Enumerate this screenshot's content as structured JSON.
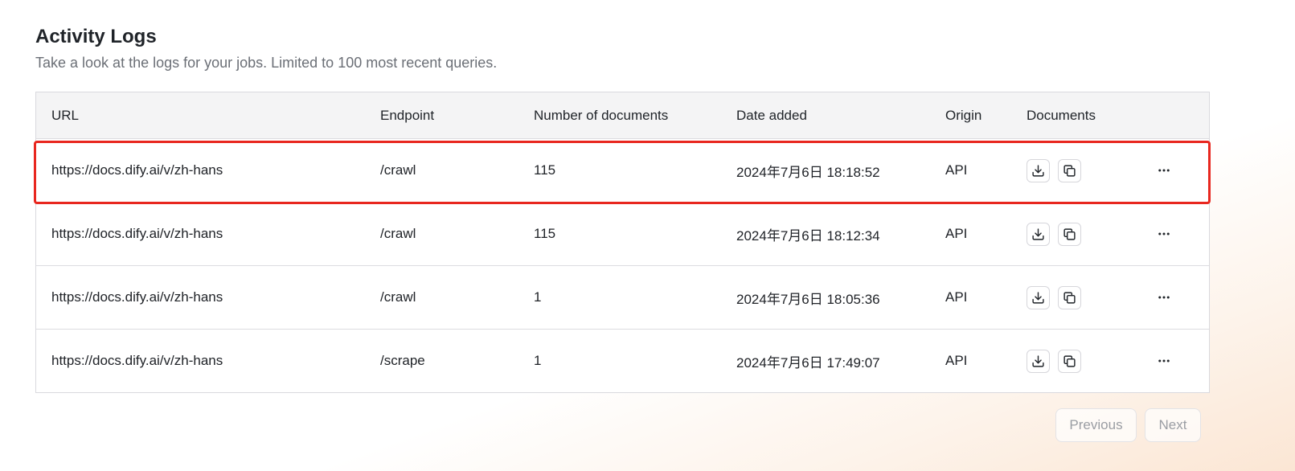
{
  "header": {
    "title": "Activity Logs",
    "subtitle": "Take a look at the logs for your jobs. Limited to 100 most recent queries."
  },
  "table": {
    "columns": {
      "url": "URL",
      "endpoint": "Endpoint",
      "num_docs": "Number of documents",
      "date_added": "Date added",
      "origin": "Origin",
      "documents": "Documents"
    },
    "rows": [
      {
        "url": "https://docs.dify.ai/v/zh-hans",
        "endpoint": "/crawl",
        "num_docs": "115",
        "date_added": "2024年7月6日 18:18:52",
        "origin": "API",
        "highlighted": true
      },
      {
        "url": "https://docs.dify.ai/v/zh-hans",
        "endpoint": "/crawl",
        "num_docs": "115",
        "date_added": "2024年7月6日 18:12:34",
        "origin": "API",
        "highlighted": false
      },
      {
        "url": "https://docs.dify.ai/v/zh-hans",
        "endpoint": "/crawl",
        "num_docs": "1",
        "date_added": "2024年7月6日 18:05:36",
        "origin": "API",
        "highlighted": false
      },
      {
        "url": "https://docs.dify.ai/v/zh-hans",
        "endpoint": "/scrape",
        "num_docs": "1",
        "date_added": "2024年7月6日 17:49:07",
        "origin": "API",
        "highlighted": false
      }
    ],
    "row_icons": {
      "download": "download-icon",
      "copy": "copy-icon",
      "more": "more-horizontal-icon"
    }
  },
  "pagination": {
    "previous_label": "Previous",
    "next_label": "Next",
    "previous_enabled": false,
    "next_enabled": false
  },
  "colors": {
    "highlight_border": "#e8271f",
    "header_bg": "#f4f4f5",
    "muted_text": "#6b6f76"
  }
}
